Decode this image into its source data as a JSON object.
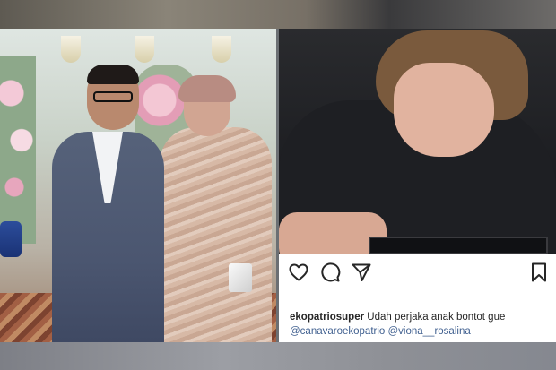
{
  "post": {
    "username": "ekopatriosuper",
    "caption_text": "Udah perjaka anak bontot gue",
    "mentions": [
      "@canavaroekopatrio",
      "@viona__rosalina"
    ]
  },
  "actions": {
    "like_icon": "heart-icon",
    "comment_icon": "comment-bubble-icon",
    "share_icon": "paper-plane-icon",
    "save_icon": "bookmark-icon"
  },
  "colors": {
    "text": "#262626",
    "mention": "#3f5f8f",
    "panel": "#ffffff"
  }
}
